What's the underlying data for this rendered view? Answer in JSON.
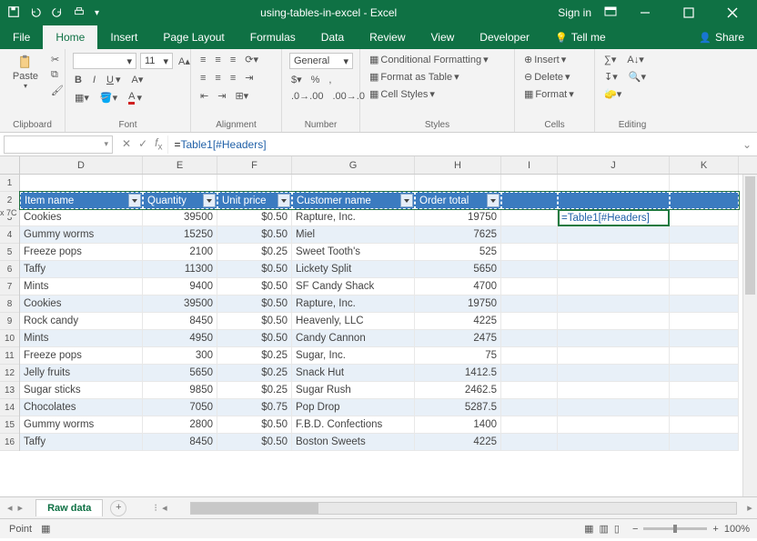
{
  "app": {
    "title": "using-tables-in-excel - Excel",
    "signin": "Sign in"
  },
  "tabs": [
    "File",
    "Home",
    "Insert",
    "Page Layout",
    "Formulas",
    "Data",
    "Review",
    "View",
    "Developer"
  ],
  "tellme": "Tell me",
  "share": "Share",
  "ribbon": {
    "clipboard": {
      "paste": "Paste",
      "label": "Clipboard"
    },
    "font": {
      "size": "11",
      "label": "Font"
    },
    "alignment": {
      "label": "Alignment"
    },
    "number": {
      "format": "General",
      "label": "Number"
    },
    "styles": {
      "cf": "Conditional Formatting",
      "fat": "Format as Table",
      "cs": "Cell Styles",
      "label": "Styles"
    },
    "cells": {
      "insert": "Insert",
      "delete": "Delete",
      "format": "Format",
      "label": "Cells"
    },
    "editing": {
      "label": "Editing"
    }
  },
  "namebox": "",
  "selection_indicator": "x 7C",
  "formula_plain": "=",
  "formula_ref": "Table1[#Headers]",
  "columns": [
    "D",
    "E",
    "F",
    "G",
    "H",
    "I",
    "J",
    "K"
  ],
  "row_start": 1,
  "row_end": 16,
  "headers": [
    "Item name",
    "Quantity",
    "Unit price",
    "Customer name",
    "Order total"
  ],
  "active_cell_text": "=Table1[#Headers]",
  "rows": [
    {
      "item": "Cookies",
      "qty": "39500",
      "price": "$0.50",
      "cust": "Rapture, Inc.",
      "total": "19750"
    },
    {
      "item": "Gummy worms",
      "qty": "15250",
      "price": "$0.50",
      "cust": "Miel",
      "total": "7625"
    },
    {
      "item": "Freeze pops",
      "qty": "2100",
      "price": "$0.25",
      "cust": "Sweet Tooth's",
      "total": "525"
    },
    {
      "item": "Taffy",
      "qty": "11300",
      "price": "$0.50",
      "cust": "Lickety Split",
      "total": "5650"
    },
    {
      "item": "Mints",
      "qty": "9400",
      "price": "$0.50",
      "cust": "SF Candy Shack",
      "total": "4700"
    },
    {
      "item": "Cookies",
      "qty": "39500",
      "price": "$0.50",
      "cust": "Rapture, Inc.",
      "total": "19750"
    },
    {
      "item": "Rock candy",
      "qty": "8450",
      "price": "$0.50",
      "cust": "Heavenly, LLC",
      "total": "4225"
    },
    {
      "item": "Mints",
      "qty": "4950",
      "price": "$0.50",
      "cust": "Candy Cannon",
      "total": "2475"
    },
    {
      "item": "Freeze pops",
      "qty": "300",
      "price": "$0.25",
      "cust": "Sugar, Inc.",
      "total": "75"
    },
    {
      "item": "Jelly fruits",
      "qty": "5650",
      "price": "$0.25",
      "cust": "Snack Hut",
      "total": "1412.5"
    },
    {
      "item": "Sugar sticks",
      "qty": "9850",
      "price": "$0.25",
      "cust": "Sugar Rush",
      "total": "2462.5"
    },
    {
      "item": "Chocolates",
      "qty": "7050",
      "price": "$0.75",
      "cust": "Pop Drop",
      "total": "5287.5"
    },
    {
      "item": "Gummy worms",
      "qty": "2800",
      "price": "$0.50",
      "cust": "F.B.D. Confections",
      "total": "1400"
    },
    {
      "item": "Taffy",
      "qty": "8450",
      "price": "$0.50",
      "cust": "Boston Sweets",
      "total": "4225"
    }
  ],
  "sheet": {
    "name": "Raw data"
  },
  "status": {
    "mode": "Point",
    "zoom": "100%"
  }
}
